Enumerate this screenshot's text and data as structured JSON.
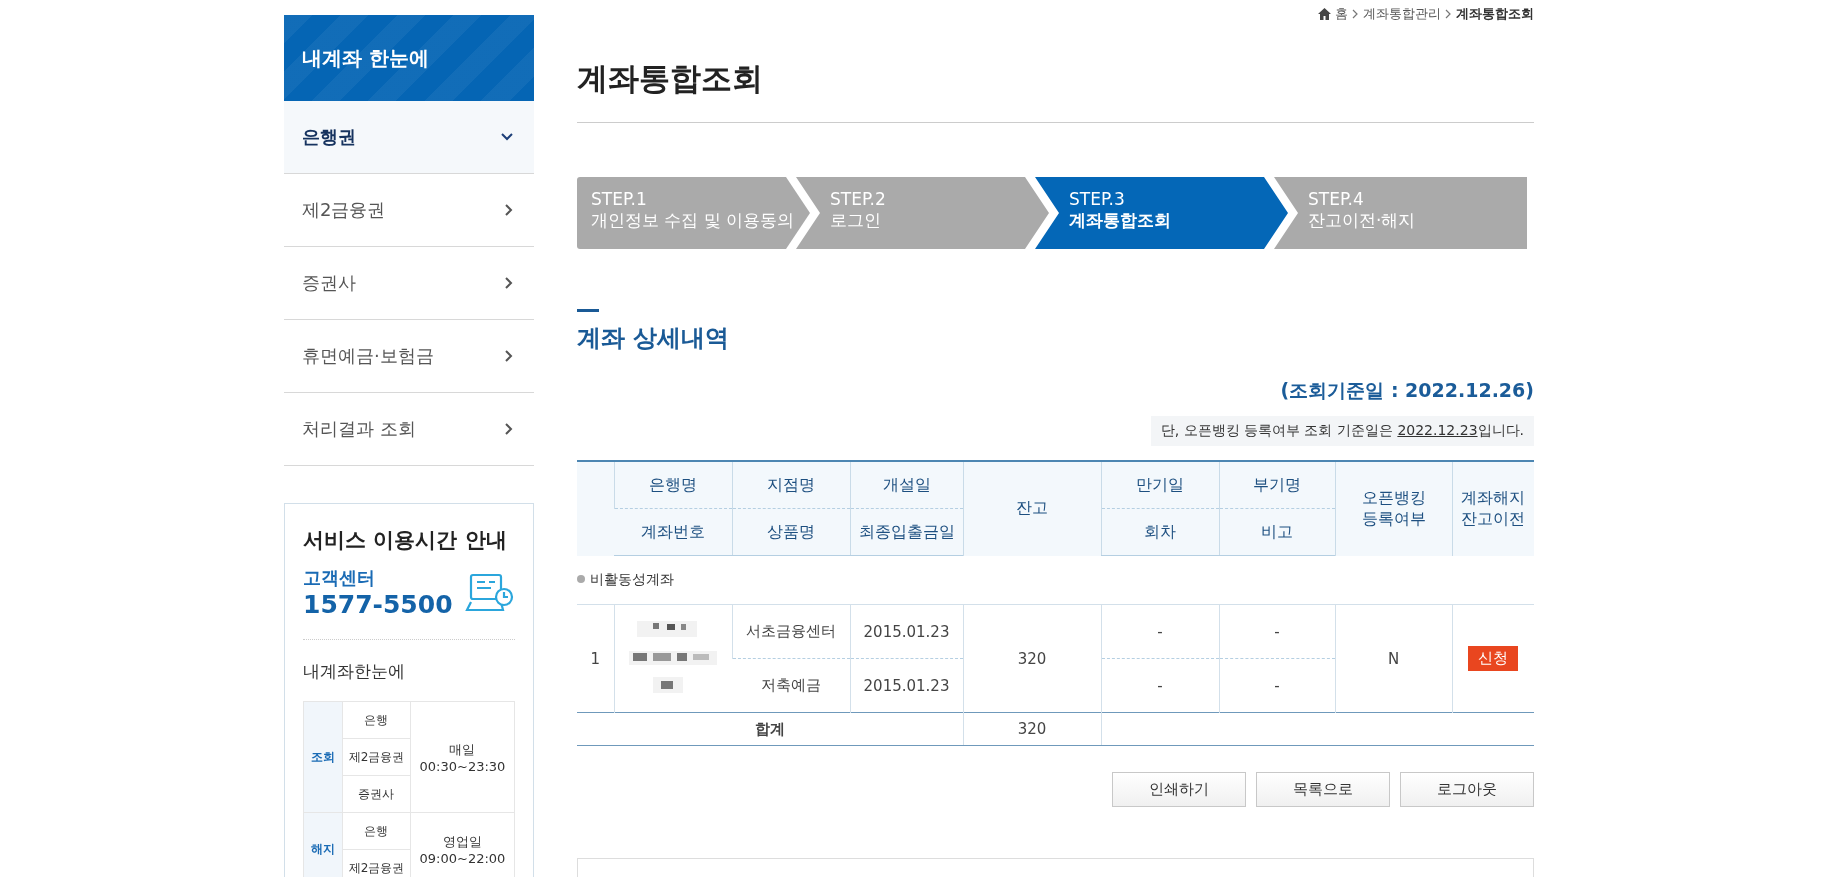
{
  "sidebar": {
    "title": "내계좌 한눈에",
    "items": [
      {
        "label": "은행권",
        "selected": true
      },
      {
        "label": "제2금융권",
        "selected": false
      },
      {
        "label": "증권사",
        "selected": false
      },
      {
        "label": "휴면예금·보험금",
        "selected": false
      },
      {
        "label": "처리결과 조회",
        "selected": false
      }
    ]
  },
  "service_info": {
    "title": "서비스 이용시간 안내",
    "center_label": "고객센터",
    "phone": "1577-5500",
    "subtitle": "내계좌한눈에",
    "schedule": [
      {
        "category": "조회",
        "types": [
          "은행",
          "제2금융권",
          "증권사"
        ],
        "hours": [
          "매일",
          "00:30~23:30"
        ]
      },
      {
        "category": "해지",
        "types": [
          "은행",
          "제2금융권"
        ],
        "hours": [
          "영업일",
          "09:00~22:00"
        ]
      }
    ]
  },
  "breadcrumb": [
    "홈",
    "계좌통합관리",
    "계좌통합조회"
  ],
  "page_title": "계좌통합조회",
  "steps": [
    {
      "step": "STEP.1",
      "label": "개인정보 수집 및 이용동의",
      "selected": false
    },
    {
      "step": "STEP.2",
      "label": "로그인",
      "selected": false
    },
    {
      "step": "STEP.3",
      "label": "계좌통합조회",
      "selected": true
    },
    {
      "step": "STEP.4",
      "label": "잔고이전·해지",
      "selected": false
    }
  ],
  "section_title": "계좌 상세내역",
  "reference_date": "(조회기준일 : 2022.12.26)",
  "note": {
    "before": "단, 오픈뱅킹 등록여부 조회 기준일은 ",
    "date": "2022.12.23",
    "after": "입니다."
  },
  "table": {
    "columns": [
      {
        "kind": "split",
        "top": "은행명",
        "bottom": "계좌번호"
      },
      {
        "kind": "split",
        "top": "지점명",
        "bottom": "상품명"
      },
      {
        "kind": "split",
        "top": "개설일",
        "bottom": "최종입출금일"
      },
      {
        "kind": "span",
        "lines": [
          "잔고"
        ]
      },
      {
        "kind": "split",
        "top": "만기일",
        "bottom": "회차"
      },
      {
        "kind": "split",
        "top": "부기명",
        "bottom": "비고"
      },
      {
        "kind": "span",
        "lines": [
          "오픈뱅킹",
          "등록여부"
        ]
      },
      {
        "kind": "span",
        "lines": [
          "계좌해지",
          "잔고이전"
        ]
      }
    ],
    "group": "비활동성계좌",
    "rows": [
      {
        "no": "1",
        "branch": "서초금융센터",
        "opened": "2015.01.23",
        "product": "저축예금",
        "last_transaction": "2015.01.23",
        "balance": "320",
        "maturity": "-",
        "installment": "-",
        "memo_name": "-",
        "remark": "-",
        "open_banking": "N",
        "action": "신청"
      }
    ],
    "total": {
      "label": "합계",
      "balance": "320"
    }
  },
  "buttons": [
    "인쇄하기",
    "목록으로",
    "로그아웃"
  ]
}
